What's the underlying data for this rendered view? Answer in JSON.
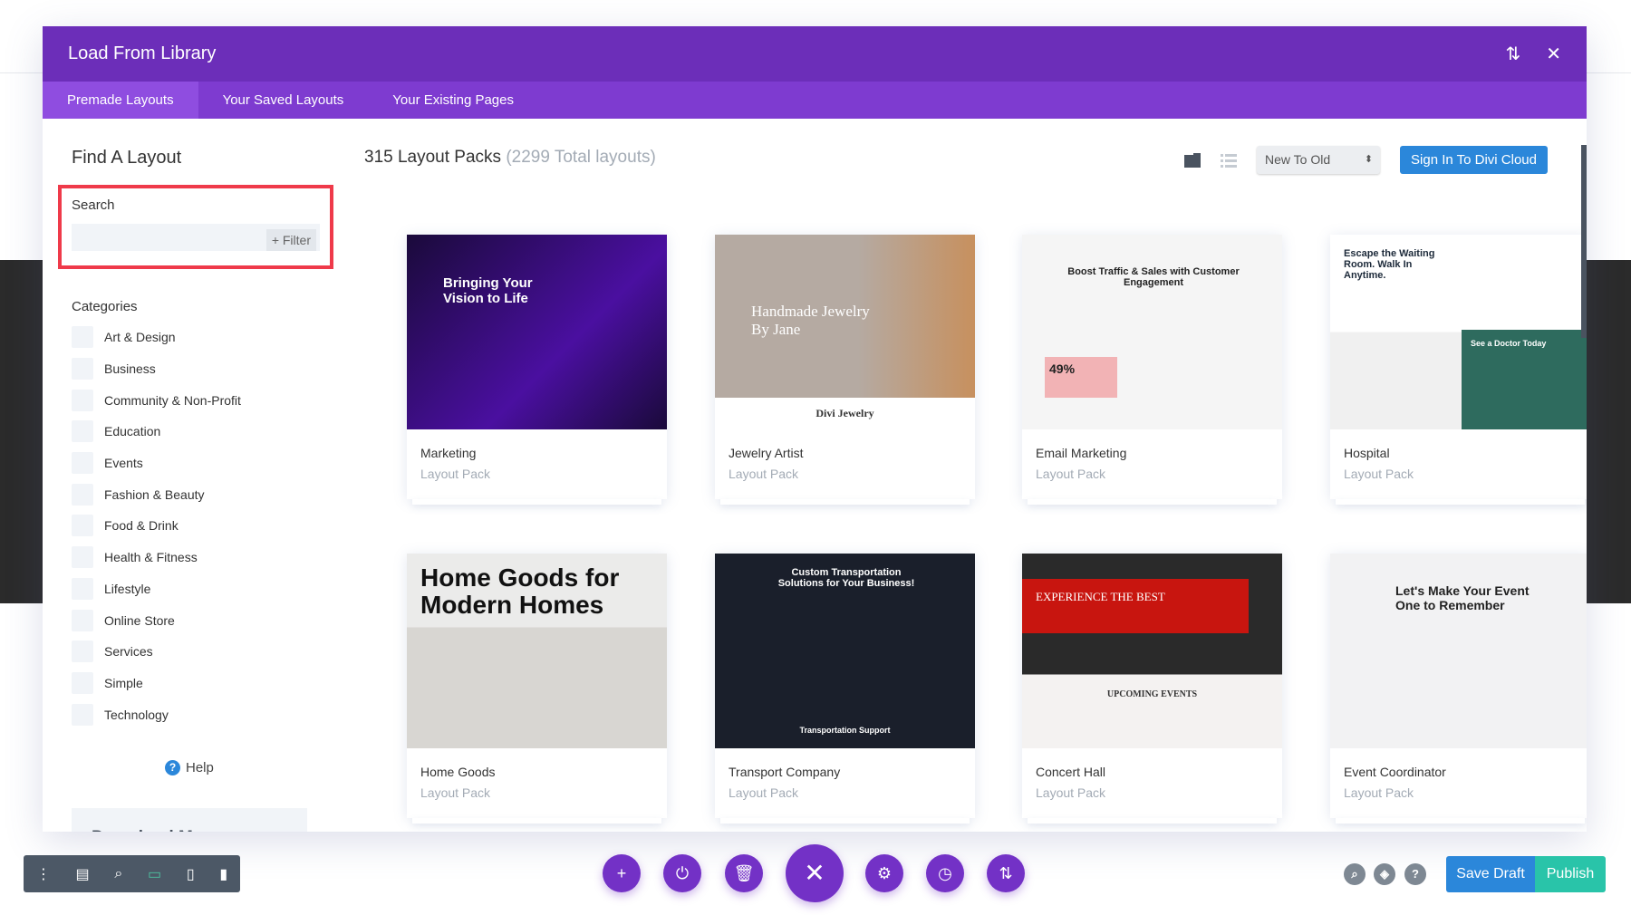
{
  "modal": {
    "title": "Load From Library",
    "tabs": [
      {
        "label": "Premade Layouts",
        "active": true
      },
      {
        "label": "Your Saved Layouts"
      },
      {
        "label": "Your Existing Pages"
      }
    ]
  },
  "sidebar": {
    "heading": "Find A Layout",
    "search_label": "Search",
    "search_value": "",
    "filter_label": "+ Filter",
    "categories_label": "Categories",
    "categories": [
      "Art & Design",
      "Business",
      "Community & Non-Profit",
      "Education",
      "Events",
      "Fashion & Beauty",
      "Food & Drink",
      "Health & Fitness",
      "Lifestyle",
      "Online Store",
      "Services",
      "Simple",
      "Technology"
    ],
    "help_label": "Help",
    "download_label": "Download More Layouts"
  },
  "main": {
    "count_label": "315 Layout Packs",
    "total_label": "(2299 Total layouts)",
    "sort_value": "New To Old",
    "signin_label": "Sign In To Divi Cloud",
    "cards": [
      {
        "name": "Marketing",
        "type": "Layout Pack",
        "headline": "Bringing Your Vision to Life"
      },
      {
        "name": "Jewelry Artist",
        "type": "Layout Pack",
        "headline": "Handmade Jewelry By Jane",
        "sub": "Divi Jewelry"
      },
      {
        "name": "Email Marketing",
        "type": "Layout Pack",
        "headline": "Boost Traffic & Sales with Customer Engagement",
        "sub": "49%"
      },
      {
        "name": "Hospital",
        "type": "Layout Pack",
        "headline": "Escape the Waiting Room. Walk In Anytime.",
        "sub": "See a Doctor Today"
      },
      {
        "name": "Home Goods",
        "type": "Layout Pack",
        "headline": "Home Goods for Modern Homes"
      },
      {
        "name": "Transport Company",
        "type": "Layout Pack",
        "headline": "Custom Transportation Solutions for Your Business!",
        "sub": "Transportation Support"
      },
      {
        "name": "Concert Hall",
        "type": "Layout Pack",
        "headline": "EXPERIENCE THE BEST",
        "sub": "UPCOMING EVENTS"
      },
      {
        "name": "Event Coordinator",
        "type": "Layout Pack",
        "headline": "Let's Make Your Event One to Remember"
      }
    ]
  },
  "footer": {
    "save_draft": "Save Draft",
    "publish": "Publish"
  },
  "colors": {
    "header": "#6c2eb9",
    "tabs": "#7e3bd0",
    "primary": "#2b87da",
    "publish": "#29c4a9",
    "highlight": "#ef3a4a"
  }
}
